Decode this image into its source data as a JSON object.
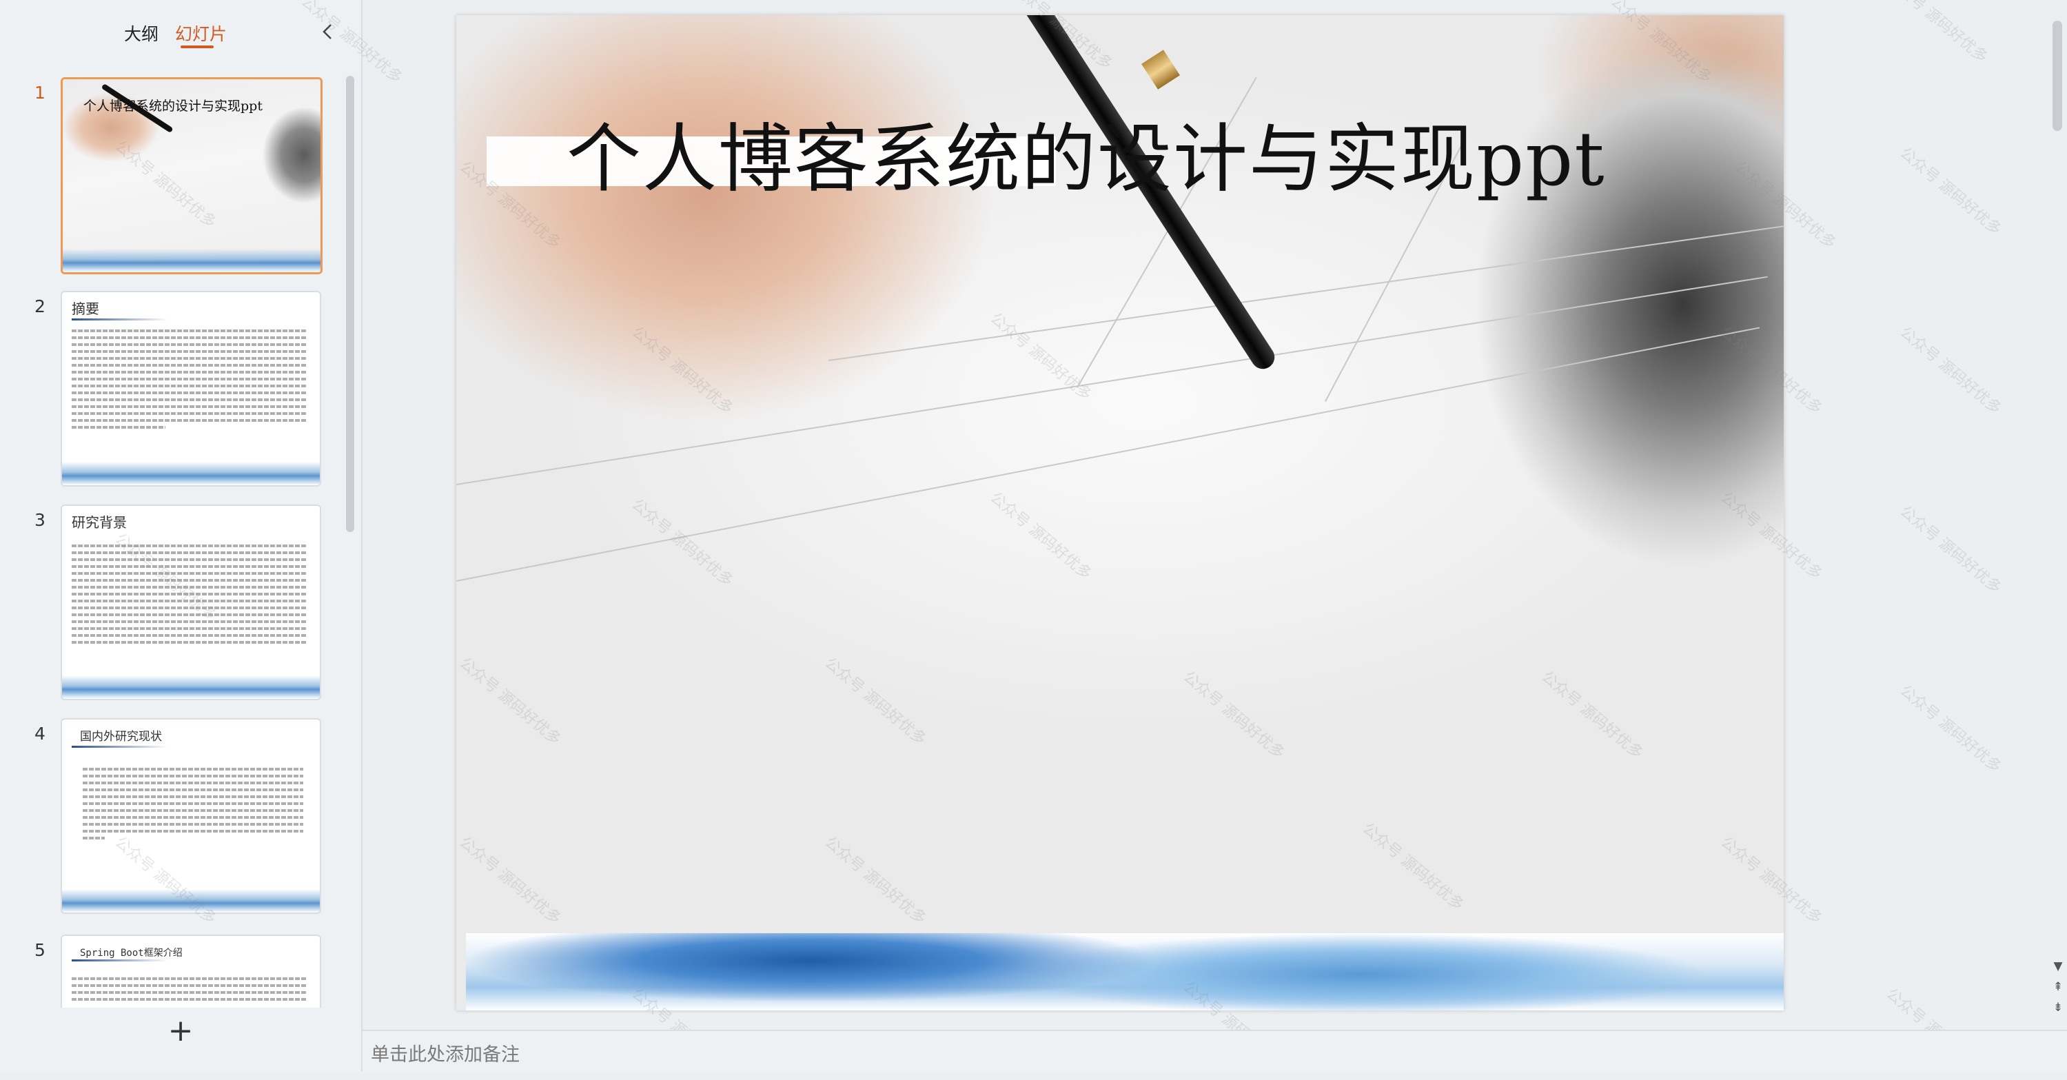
{
  "panel": {
    "tab_outline": "大纲",
    "tab_slides": "幻灯片",
    "collapse_icon": "chevron-left-icon"
  },
  "slides": [
    {
      "num": "1",
      "title": "个人博客系统的设计与实现ppt"
    },
    {
      "num": "2",
      "title": "摘要"
    },
    {
      "num": "3",
      "title": "研究背景"
    },
    {
      "num": "4",
      "title": "国内外研究现状"
    },
    {
      "num": "5",
      "title": "Spring Boot框架介绍"
    }
  ],
  "add_slide": "+",
  "current_slide": {
    "title": "个人博客系统的设计与实现ppt"
  },
  "notes": {
    "placeholder": "单击此处添加备注"
  },
  "watermark_text": "公众号 源码好优多",
  "scroll_controls": {
    "down": "▼",
    "prev_page": "⇞",
    "next_page": "⇟"
  },
  "colors": {
    "accent": "#d35a1f",
    "active_border": "#ee9a56",
    "panel_bg": "#eef1f4"
  }
}
